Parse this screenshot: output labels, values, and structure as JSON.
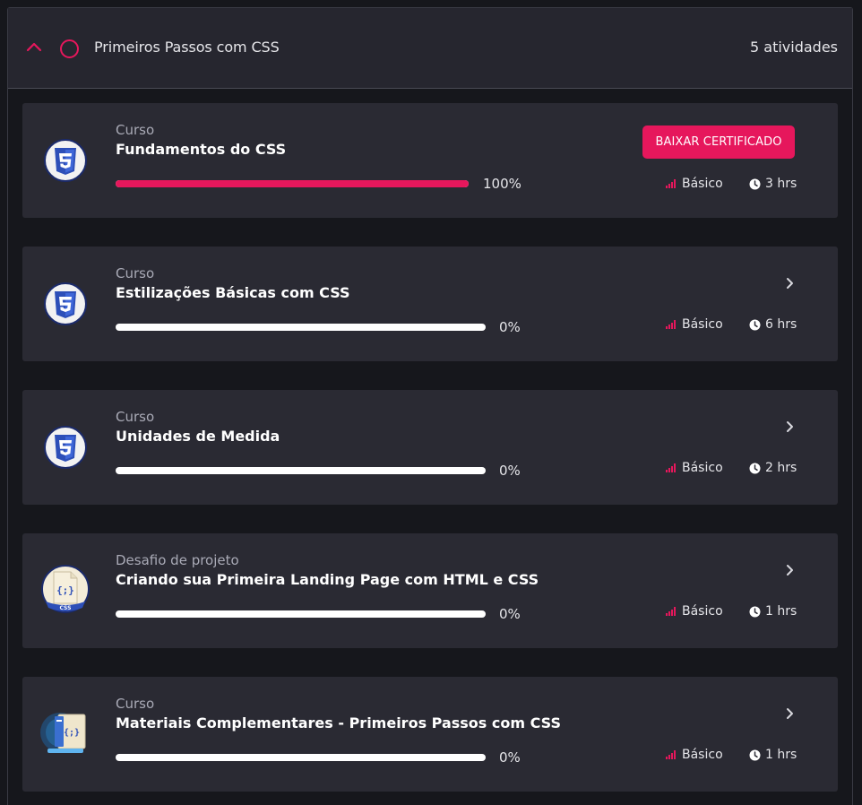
{
  "module": {
    "title": "Primeiros Passos com CSS",
    "count": "5 atividades"
  },
  "colors": {
    "accent": "#e6175c",
    "card": "#2a2a33",
    "background": "#16171c"
  },
  "cards": [
    {
      "kind": "Curso",
      "title": "Fundamentos do CSS",
      "progress": 100,
      "progress_label": "100%",
      "level": "Básico",
      "duration": "3 hrs",
      "action": "BAIXAR CERTIFICADO",
      "icon": "css3-icon"
    },
    {
      "kind": "Curso",
      "title": "Estilizações Básicas com CSS",
      "progress": 0,
      "progress_label": "0%",
      "level": "Básico",
      "duration": "6 hrs",
      "icon": "css3-icon"
    },
    {
      "kind": "Curso",
      "title": "Unidades de Medida",
      "progress": 0,
      "progress_label": "0%",
      "level": "Básico",
      "duration": "2 hrs",
      "icon": "css3-icon"
    },
    {
      "kind": "Desafio de projeto",
      "title": "Criando sua Primeira Landing Page com HTML e CSS",
      "progress": 0,
      "progress_label": "0%",
      "level": "Básico",
      "duration": "1 hrs",
      "icon": "css-file-icon",
      "icon_text": "CSS"
    },
    {
      "kind": "Curso",
      "title": "Materiais Complementares - Primeiros Passos com CSS",
      "progress": 0,
      "progress_label": "0%",
      "level": "Básico",
      "duration": "1 hrs",
      "icon": "code-document-icon"
    }
  ]
}
